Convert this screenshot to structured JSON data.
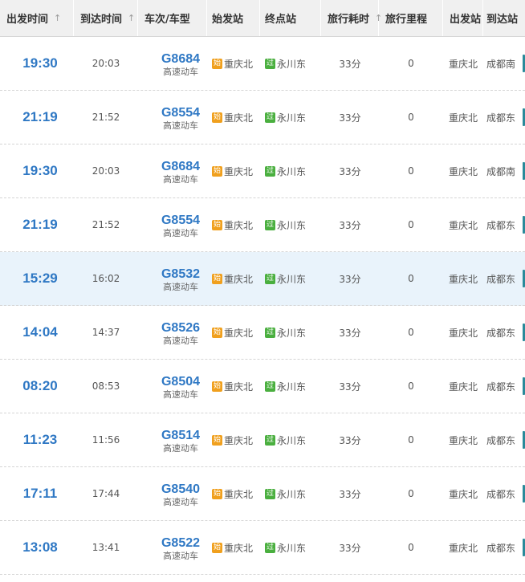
{
  "header": {
    "columns": [
      {
        "label": "出发时间",
        "sortable": true
      },
      {
        "label": "到达时间",
        "sortable": true
      },
      {
        "label": "车次/车型",
        "sortable": false
      },
      {
        "label": "始发站",
        "sortable": false
      },
      {
        "label": "终点站",
        "sortable": false
      },
      {
        "label": "旅行耗时",
        "sortable": true
      },
      {
        "label": "旅行里程",
        "sortable": false
      },
      {
        "label": "出发站",
        "sortable": false
      },
      {
        "label": "到达站",
        "sortable": false
      }
    ],
    "sort_arrow": "↑"
  },
  "badges": {
    "start": "始",
    "pass": "过"
  },
  "colors": {
    "accent": "#2f78c4",
    "start_badge": "#f0a01e",
    "pass_badge": "#4aaf3f",
    "highlight_row": "#e9f3fb"
  },
  "rows": [
    {
      "dep": "19:30",
      "arr": "20:03",
      "train": "G8684",
      "type": "高速动车",
      "origin": "重庆北",
      "terminus": "永川东",
      "duration": "33分",
      "distance": "0",
      "from": "重庆北",
      "to": "成都南",
      "highlight": false
    },
    {
      "dep": "21:19",
      "arr": "21:52",
      "train": "G8554",
      "type": "高速动车",
      "origin": "重庆北",
      "terminus": "永川东",
      "duration": "33分",
      "distance": "0",
      "from": "重庆北",
      "to": "成都东",
      "highlight": false
    },
    {
      "dep": "19:30",
      "arr": "20:03",
      "train": "G8684",
      "type": "高速动车",
      "origin": "重庆北",
      "terminus": "永川东",
      "duration": "33分",
      "distance": "0",
      "from": "重庆北",
      "to": "成都南",
      "highlight": false
    },
    {
      "dep": "21:19",
      "arr": "21:52",
      "train": "G8554",
      "type": "高速动车",
      "origin": "重庆北",
      "terminus": "永川东",
      "duration": "33分",
      "distance": "0",
      "from": "重庆北",
      "to": "成都东",
      "highlight": false
    },
    {
      "dep": "15:29",
      "arr": "16:02",
      "train": "G8532",
      "type": "高速动车",
      "origin": "重庆北",
      "terminus": "永川东",
      "duration": "33分",
      "distance": "0",
      "from": "重庆北",
      "to": "成都东",
      "highlight": true
    },
    {
      "dep": "14:04",
      "arr": "14:37",
      "train": "G8526",
      "type": "高速动车",
      "origin": "重庆北",
      "terminus": "永川东",
      "duration": "33分",
      "distance": "0",
      "from": "重庆北",
      "to": "成都东",
      "highlight": false
    },
    {
      "dep": "08:20",
      "arr": "08:53",
      "train": "G8504",
      "type": "高速动车",
      "origin": "重庆北",
      "terminus": "永川东",
      "duration": "33分",
      "distance": "0",
      "from": "重庆北",
      "to": "成都东",
      "highlight": false
    },
    {
      "dep": "11:23",
      "arr": "11:56",
      "train": "G8514",
      "type": "高速动车",
      "origin": "重庆北",
      "terminus": "永川东",
      "duration": "33分",
      "distance": "0",
      "from": "重庆北",
      "to": "成都东",
      "highlight": false
    },
    {
      "dep": "17:11",
      "arr": "17:44",
      "train": "G8540",
      "type": "高速动车",
      "origin": "重庆北",
      "terminus": "永川东",
      "duration": "33分",
      "distance": "0",
      "from": "重庆北",
      "to": "成都东",
      "highlight": false
    },
    {
      "dep": "13:08",
      "arr": "13:41",
      "train": "G8522",
      "type": "高速动车",
      "origin": "重庆北",
      "terminus": "永川东",
      "duration": "33分",
      "distance": "0",
      "from": "重庆北",
      "to": "成都东",
      "highlight": false
    }
  ]
}
